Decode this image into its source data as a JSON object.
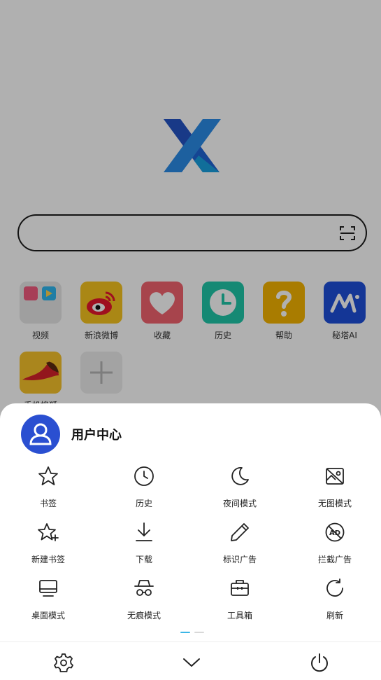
{
  "shortcuts": [
    {
      "label": "视频",
      "icon": "video-folder-icon"
    },
    {
      "label": "新浪微博",
      "icon": "weibo-icon"
    },
    {
      "label": "收藏",
      "icon": "heart-icon"
    },
    {
      "label": "历史",
      "icon": "clock-icon"
    },
    {
      "label": "帮助",
      "icon": "help-icon"
    },
    {
      "label": "秘塔AI",
      "icon": "metaso-ai-icon"
    },
    {
      "label": "手机搜狐",
      "icon": "sohu-icon"
    },
    {
      "label": "",
      "icon": "add-icon"
    }
  ],
  "sheet": {
    "user_center": "用户中心",
    "menu": [
      {
        "label": "书签",
        "icon": "star-icon"
      },
      {
        "label": "历史",
        "icon": "clock-icon"
      },
      {
        "label": "夜间模式",
        "icon": "moon-icon"
      },
      {
        "label": "无图模式",
        "icon": "no-image-icon"
      },
      {
        "label": "新建书签",
        "icon": "star-plus-icon"
      },
      {
        "label": "下载",
        "icon": "download-icon"
      },
      {
        "label": "标识广告",
        "icon": "pencil-icon"
      },
      {
        "label": "拦截广告",
        "icon": "ad-block-icon"
      },
      {
        "label": "桌面模式",
        "icon": "desktop-icon"
      },
      {
        "label": "无痕模式",
        "icon": "incognito-icon"
      },
      {
        "label": "工具箱",
        "icon": "toolbox-icon"
      },
      {
        "label": "刷新",
        "icon": "refresh-icon"
      }
    ],
    "page_indicator": {
      "pages": 2,
      "current": 1
    }
  },
  "bottom_bar": [
    "settings-icon",
    "chevron-down-icon",
    "power-icon"
  ],
  "colors": {
    "avatar": "#2a4fd1",
    "indicator_active": "#3bb6e6",
    "scrim": "rgba(0,0,0,0.31)"
  }
}
